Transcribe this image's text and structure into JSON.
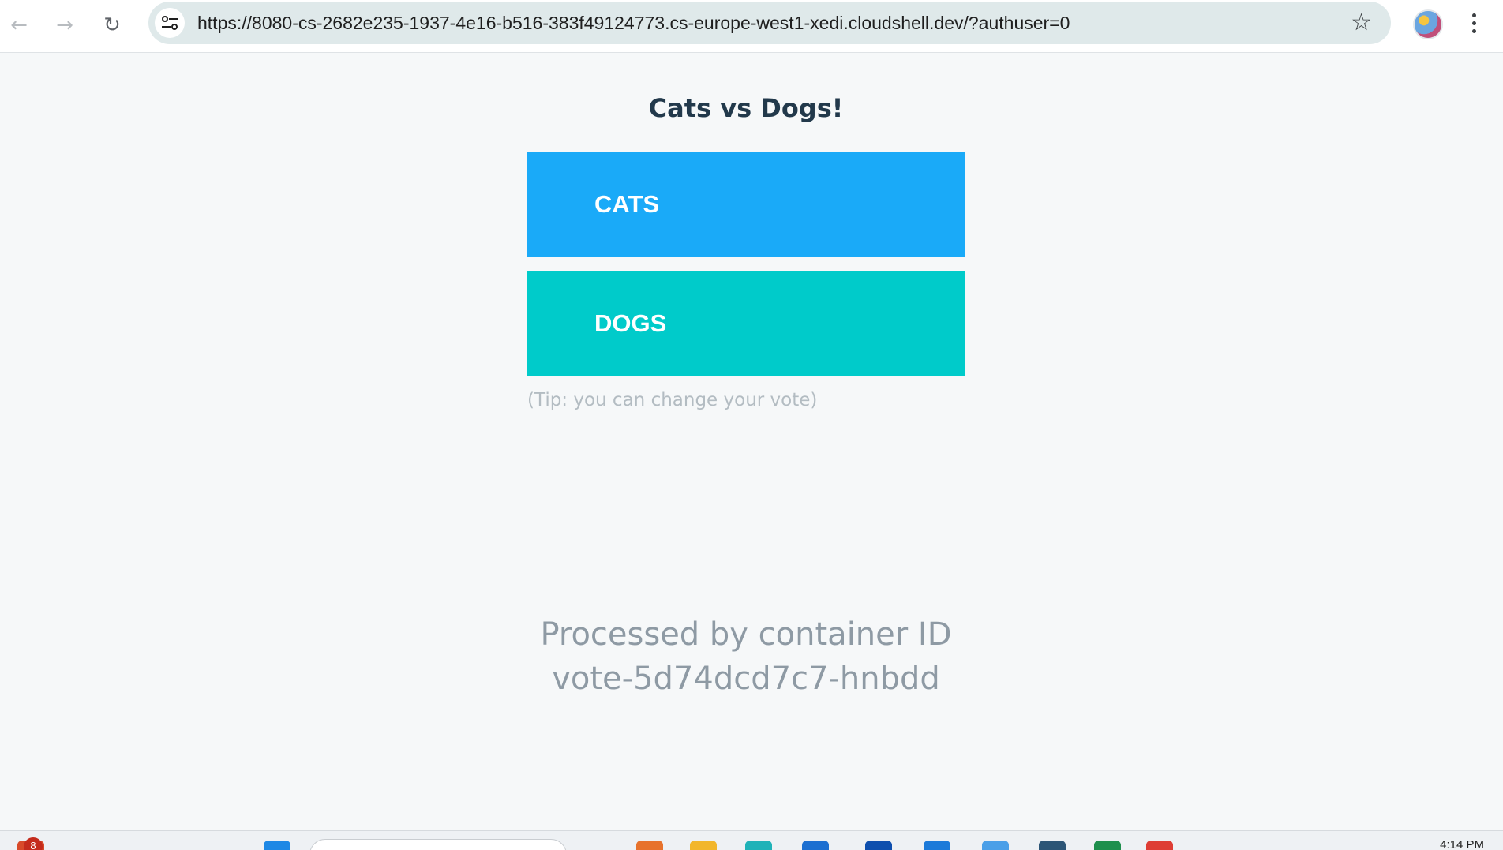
{
  "browser": {
    "url": "https://8080-cs-2682e235-1937-4e16-b516-383f49124773.cs-europe-west1-xedi.cloudshell.dev/?authuser=0",
    "back_icon": "arrow-left-icon",
    "forward_icon": "arrow-right-icon",
    "reload_icon": "reload-icon",
    "bookmark_icon": "star-icon",
    "menu_icon": "kebab-menu-icon"
  },
  "page": {
    "title": "Cats vs Dogs!",
    "option_a": "CATS",
    "option_b": "DOGS",
    "tip": "(Tip: you can change your vote)",
    "processed_label": "Processed by container ID",
    "container_id": "vote-5d74dcd7c7-hnbdd"
  },
  "taskbar": {
    "notification_count": "8",
    "clock": "4:14 PM"
  },
  "colors": {
    "cats_button": "#1aaaf8",
    "dogs_button": "#00cbca",
    "title": "#22394b",
    "background": "#f6f8f9"
  }
}
